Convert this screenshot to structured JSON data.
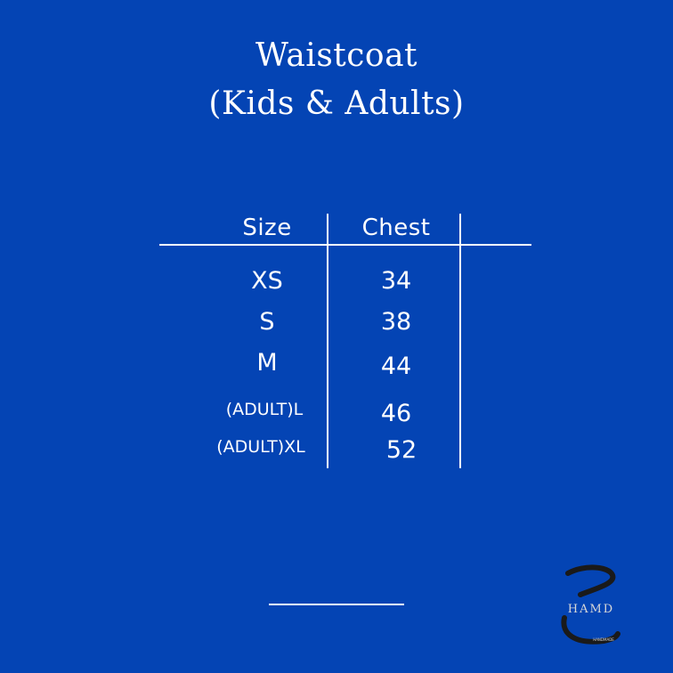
{
  "title": {
    "line1": "Waistcoat",
    "line2": "(Kids & Adults)"
  },
  "table": {
    "headers": [
      "Size",
      "Chest"
    ],
    "rows": [
      {
        "size": "XS",
        "chest": "34"
      },
      {
        "size": "S",
        "chest": "38"
      },
      {
        "size": "M",
        "chest": "44"
      },
      {
        "size": "(ADULT)L",
        "chest": "46"
      },
      {
        "size": "(ADULT)XL",
        "chest": "52"
      }
    ]
  },
  "logo": {
    "text": "HAMD",
    "tagline": "HANDMADE",
    "colors": {
      "mark": "#1a1a1a",
      "text": "#d8d8d8"
    }
  },
  "colors": {
    "background": "#0444b4",
    "foreground": "#ffffff"
  }
}
